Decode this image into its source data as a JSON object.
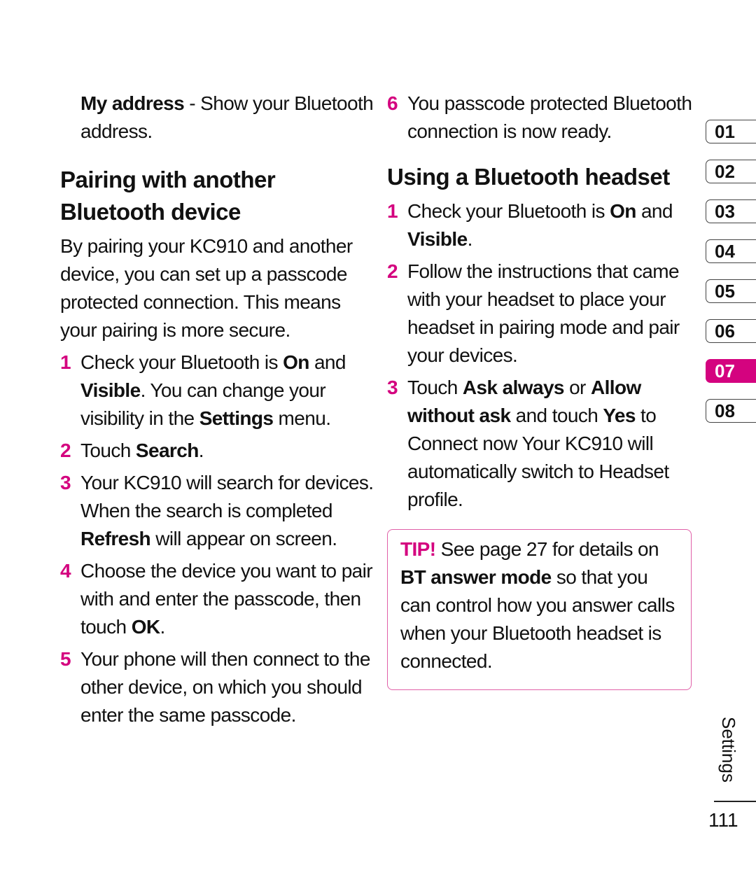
{
  "left": {
    "intro": {
      "bold": "My address",
      "text": " - Show your Bluetooth address."
    },
    "heading": "Pairing with another Bluetooth device",
    "paragraph": "By pairing your KC910 and another device, you can set up a passcode protected connection. This means your pairing is more secure.",
    "steps": [
      {
        "num": "1",
        "parts": [
          {
            "t": "Check your Bluetooth is ",
            "b": false
          },
          {
            "t": "On",
            "b": true
          },
          {
            "t": " and ",
            "b": false
          },
          {
            "t": "Visible",
            "b": true
          },
          {
            "t": ". You can change your visibility in the ",
            "b": false
          },
          {
            "t": "Settings",
            "b": true
          },
          {
            "t": " menu.",
            "b": false
          }
        ]
      },
      {
        "num": "2",
        "parts": [
          {
            "t": "Touch ",
            "b": false
          },
          {
            "t": "Search",
            "b": true
          },
          {
            "t": ".",
            "b": false
          }
        ]
      },
      {
        "num": "3",
        "parts": [
          {
            "t": "Your KC910 will search for devices. When the search is completed ",
            "b": false
          },
          {
            "t": "Refresh",
            "b": true
          },
          {
            "t": " will appear on screen.",
            "b": false
          }
        ]
      },
      {
        "num": "4",
        "parts": [
          {
            "t": "Choose the device you want to pair with and enter the passcode, then touch ",
            "b": false
          },
          {
            "t": "OK",
            "b": true
          },
          {
            "t": ".",
            "b": false
          }
        ]
      },
      {
        "num": "5",
        "parts": [
          {
            "t": "Your phone will then connect to the other device, on which you should enter the same passcode.",
            "b": false
          }
        ]
      }
    ]
  },
  "right": {
    "step6": {
      "num": "6",
      "parts": [
        {
          "t": "You passcode protected Bluetooth connection is now ready.",
          "b": false
        }
      ]
    },
    "heading": "Using a Bluetooth headset",
    "steps": [
      {
        "num": "1",
        "parts": [
          {
            "t": "Check your Bluetooth is ",
            "b": false
          },
          {
            "t": "On",
            "b": true
          },
          {
            "t": " and ",
            "b": false
          },
          {
            "t": "Visible",
            "b": true
          },
          {
            "t": ".",
            "b": false
          }
        ]
      },
      {
        "num": "2",
        "parts": [
          {
            "t": "Follow the instructions that came with your headset to place your headset in pairing mode and pair your devices.",
            "b": false
          }
        ]
      },
      {
        "num": "3",
        "parts": [
          {
            "t": "Touch ",
            "b": false
          },
          {
            "t": "Ask always",
            "b": true
          },
          {
            "t": " or ",
            "b": false
          },
          {
            "t": "Allow without ask",
            "b": true
          },
          {
            "t": " and touch ",
            "b": false
          },
          {
            "t": "Yes",
            "b": true
          },
          {
            "t": " to Connect now Your KC910 will automatically switch to Headset profile.",
            "b": false
          }
        ]
      }
    ],
    "tip": {
      "label": "TIP!",
      "text1": " See page 27 for details on ",
      "bold": "BT answer mode",
      "text2": " so that you can control how you answer calls when your Bluetooth headset is connected."
    }
  },
  "chapter_tabs": [
    {
      "label": "01",
      "active": false
    },
    {
      "label": "02",
      "active": false
    },
    {
      "label": "03",
      "active": false
    },
    {
      "label": "04",
      "active": false
    },
    {
      "label": "05",
      "active": false
    },
    {
      "label": "06",
      "active": false
    },
    {
      "label": "07",
      "active": true
    },
    {
      "label": "08",
      "active": false
    }
  ],
  "section_label": "Settings",
  "page_number": "111",
  "colors": {
    "accent": "#d4037f",
    "tip_border": "#e060a8"
  }
}
